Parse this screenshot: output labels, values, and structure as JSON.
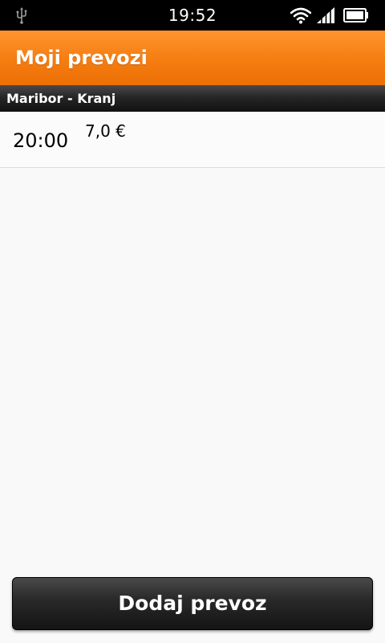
{
  "status_bar": {
    "time": "19:52",
    "icons": [
      "usb-icon",
      "wifi-icon",
      "signal-icon",
      "battery-icon"
    ]
  },
  "action_bar": {
    "title": "Moji prevozi",
    "color": "#f47d10"
  },
  "section": {
    "title": "Maribor - Kranj"
  },
  "rides": [
    {
      "time": "20:00",
      "price": "7,0 €"
    }
  ],
  "add_button": {
    "label": "Dodaj prevoz"
  }
}
